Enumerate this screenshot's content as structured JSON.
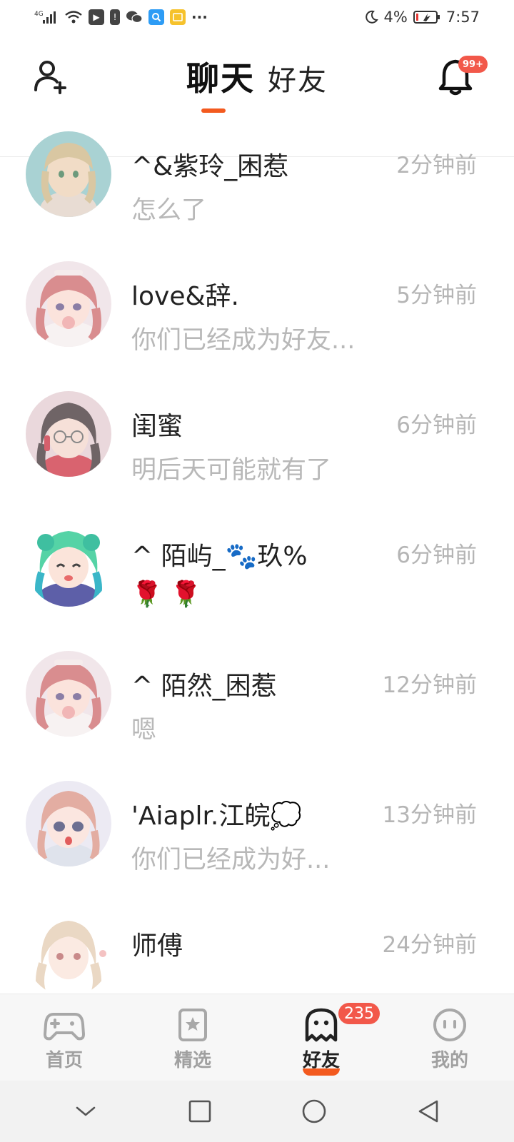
{
  "status_bar": {
    "network": "4G",
    "battery": "4%",
    "time": "7:57"
  },
  "header": {
    "tabs": [
      {
        "label": "聊天",
        "active": true
      },
      {
        "label": "好友",
        "active": false
      }
    ],
    "notification_badge": "99+",
    "accent_color": "#f35a1f"
  },
  "chats": [
    {
      "name": "^&紫玲_困惹",
      "time": "2分钟前",
      "message": "怎么了",
      "avatar": "avatar-blonde-girl"
    },
    {
      "name": "love&辞.",
      "time": "5分钟前",
      "message": "你们已经成为好友...",
      "avatar": "avatar-pink-hair-girl"
    },
    {
      "name": "闺蜜",
      "time": "6分钟前",
      "message": "明后天可能就有了",
      "avatar": "avatar-glasses-girl"
    },
    {
      "name": "^ 陌屿_🐾玖%",
      "time": "6分钟前",
      "message": "🌹 🌹",
      "avatar": "avatar-green-hair-girl"
    },
    {
      "name": "^ 陌然_困惹",
      "time": "12分钟前",
      "message": "嗯",
      "avatar": "avatar-pink-hair-girl"
    },
    {
      "name": "'Aiaplr.江皖💭",
      "time": "13分钟前",
      "message": "你们已经成为好...",
      "avatar": "avatar-brown-hair-girl"
    },
    {
      "name": "师傅",
      "time": "24分钟前",
      "message": "",
      "avatar": "avatar-light-hair-girl"
    }
  ],
  "bottom_nav": [
    {
      "label": "首页",
      "icon": "gamepad-icon",
      "active": false
    },
    {
      "label": "精选",
      "icon": "star-card-icon",
      "active": false
    },
    {
      "label": "好友",
      "icon": "ghost-icon",
      "active": true,
      "badge": "235"
    },
    {
      "label": "我的",
      "icon": "face-icon",
      "active": false
    }
  ]
}
